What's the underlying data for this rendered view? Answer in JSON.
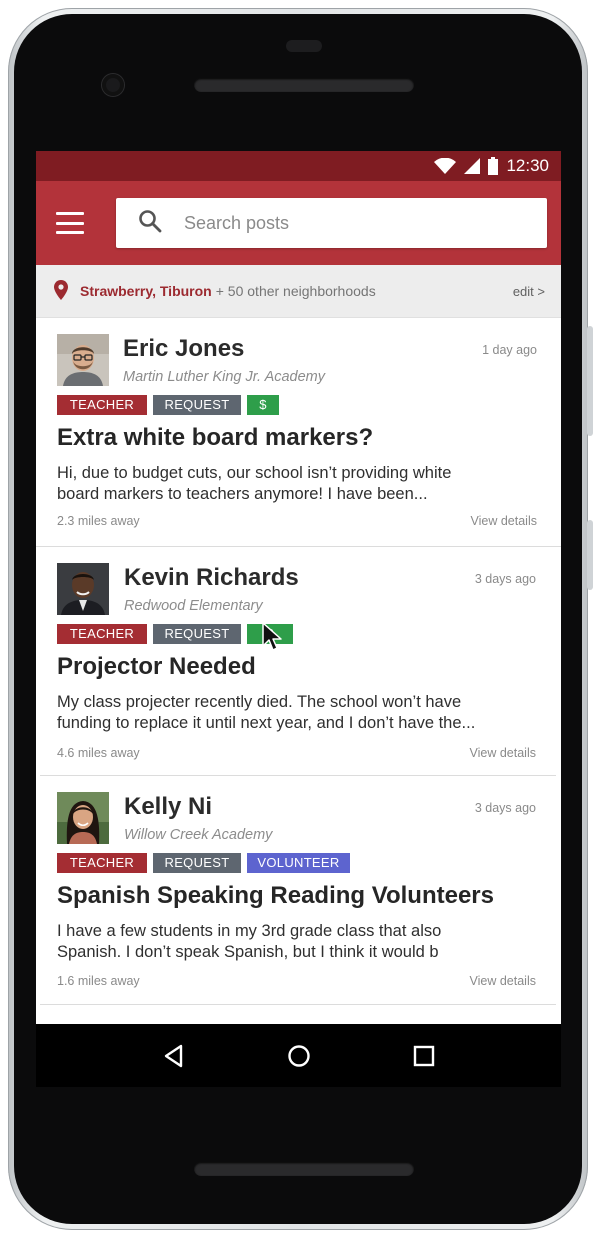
{
  "status_bar": {
    "time": "12:30"
  },
  "app_bar": {
    "search_placeholder": "Search posts"
  },
  "location": {
    "primary": "Strawberry, Tiburon",
    "secondary": "+ 50 other neighborhoods",
    "edit_label": "edit >"
  },
  "posts": [
    {
      "author": "Eric Jones",
      "school": "Martin Luther King Jr. Academy",
      "time": "1 day ago",
      "tags": [
        "TEACHER",
        "REQUEST",
        "$"
      ],
      "title": "Extra white board markers?",
      "body": "Hi, due to budget cuts, our school isn’t providing white board markers to teachers anymore! I have been...",
      "distance": "2.3 miles away",
      "details_label": "View details"
    },
    {
      "author": "Kevin Richards",
      "school": "Redwood Elementary",
      "time": "3 days ago",
      "tags": [
        "TEACHER",
        "REQUEST",
        "$"
      ],
      "title": "Projector Needed",
      "body": "My class projecter recently died. The school won’t have funding to replace it until next year, and I don’t have the...",
      "distance": "4.6 miles away",
      "details_label": "View details"
    },
    {
      "author": "Kelly Ni",
      "school": "Willow Creek Academy",
      "time": "3 days ago",
      "tags": [
        "TEACHER",
        "REQUEST",
        "VOLUNTEER"
      ],
      "title": "Spanish Speaking Reading Volunteers",
      "body": "I have a few students in my 3rd grade class that also Spanish. I don’t speak Spanish, but I think it would b",
      "distance": "1.6 miles away",
      "details_label": "View details"
    }
  ],
  "fab": {
    "icon": "plus-icon"
  },
  "colors": {
    "status_bar": "#7f1c22",
    "app_bar": "#b3333a",
    "teacher_tag": "#a42d33",
    "request_tag": "#5e6670",
    "money_tag": "#2e9e4a",
    "volunteer_tag": "#5d64cf"
  }
}
